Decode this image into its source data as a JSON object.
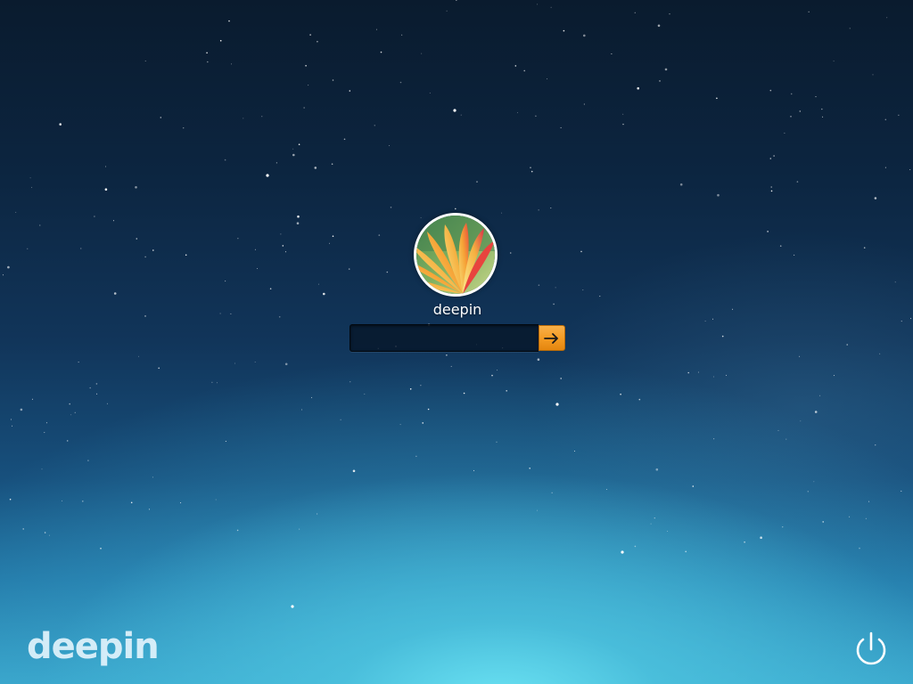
{
  "user": {
    "name": "deepin",
    "avatar_icon": "flower-avatar"
  },
  "password": {
    "value": "",
    "placeholder": ""
  },
  "submit": {
    "icon": "arrow-right-icon",
    "color": "#f39a22"
  },
  "branding": {
    "logo_text": "deepin"
  },
  "power": {
    "icon": "power-icon"
  },
  "theme": {
    "sky_top": "#0a1b2e",
    "sky_bottom": "#3aa6cb",
    "glow": "#6ee6f5"
  }
}
